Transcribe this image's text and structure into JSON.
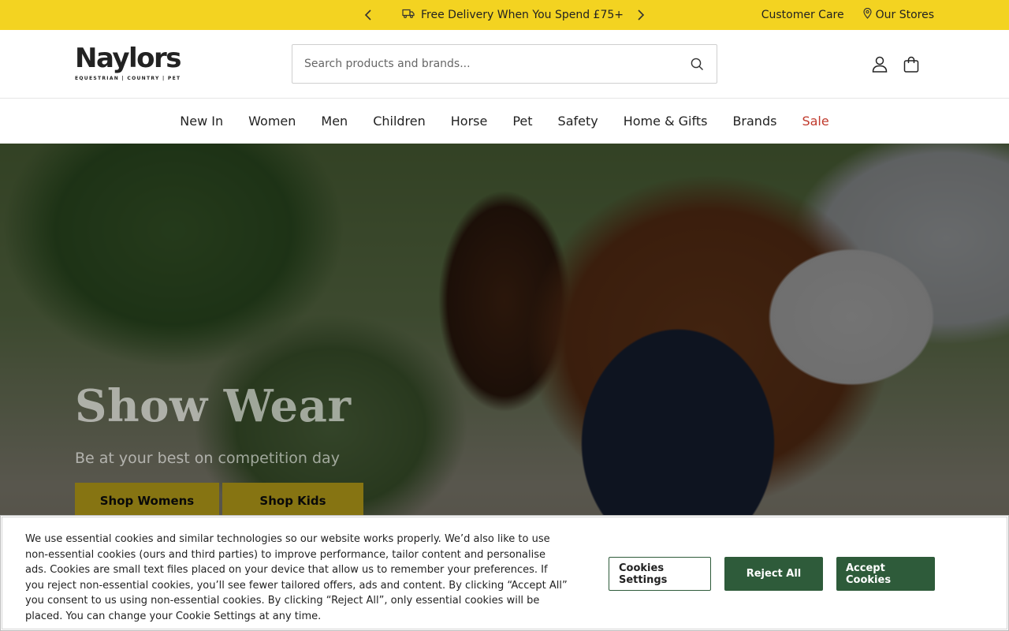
{
  "colors": {
    "promo_bar": "#f3d321",
    "sale": "#c0392b",
    "cookie_primary": "#2e5b3a"
  },
  "promo": {
    "text": "Free Delivery When You Spend £75+",
    "icon": "delivery-truck-icon"
  },
  "top_links": {
    "customer_care": "Customer Care",
    "our_stores": "Our Stores"
  },
  "logo": {
    "brand": "Naylors",
    "tagline": "EQUESTRIAN | COUNTRY | PET"
  },
  "search": {
    "placeholder": "Search products and brands..."
  },
  "nav": [
    "New In",
    "Women",
    "Men",
    "Children",
    "Horse",
    "Pet",
    "Safety",
    "Home & Gifts",
    "Brands",
    "Sale"
  ],
  "hero": {
    "title": "Show Wear",
    "subtitle": "Be at your best on competition day",
    "buttons": [
      "Shop Womens",
      "Shop Kids"
    ]
  },
  "cookie": {
    "text": "We use essential cookies and similar technologies so our website works properly. We’d also like to use non-essential cookies (ours and third parties) to improve performance, tailor content and personalise ads. Cookies are small text files placed on your device that allow us to remember your preferences. If you reject non-essential cookies, you’ll see fewer tailored offers, ads and content. By clicking “Accept All” you consent to us using non-essential cookies. By clicking “Reject All”, only essential cookies will be placed. You can change your Cookie Settings at any time.",
    "settings": "Cookies Settings",
    "reject": "Reject All",
    "accept": "Accept Cookies"
  }
}
